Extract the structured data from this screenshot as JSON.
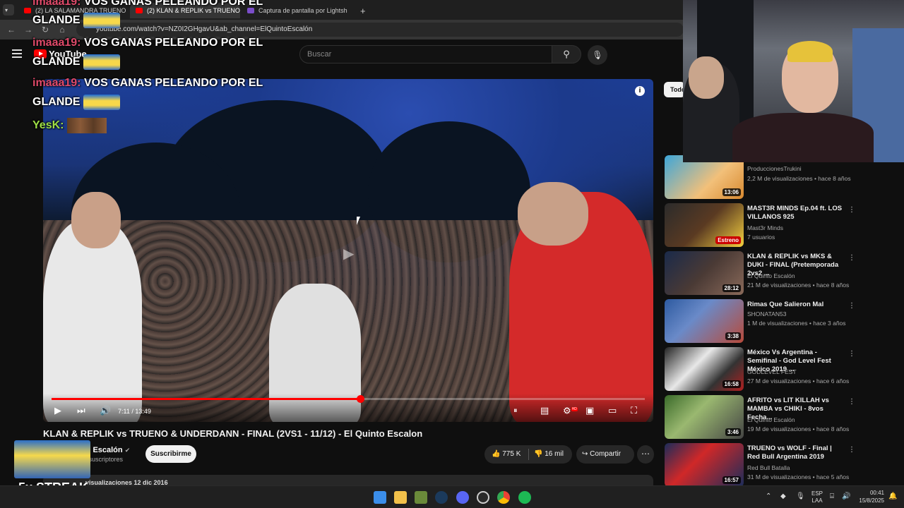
{
  "browser": {
    "tabs": [
      {
        "label": "(2) LA SALAMANDRA TRUENO",
        "close": "×"
      },
      {
        "label": "(2) KLAN & REPLIK vs TRUENO",
        "close": "×"
      },
      {
        "label": "Captura de pantalla por Lightsh",
        "close": "×"
      }
    ],
    "new_tab": "+",
    "url": "youtube.com/watch?v=NZ0I2GHgavU&ab_channel=ElQuintoEscalón"
  },
  "youtube": {
    "logo_text": "YouTube",
    "search_placeholder": "Buscar",
    "player": {
      "time": "7:11 / 13:49",
      "progress_fraction": 0.52,
      "hd_badge": "HD"
    },
    "video_title": "KLAN & REPLIK vs TRUENO & UNDERDANN - FINAL (2VS1 - 11/12) - El Quinto Escalon",
    "channel_name": "to Escalón",
    "subscribers": "e suscriptores",
    "subscribe_label": "Suscribirme",
    "likes": "775 K",
    "dislikes": "16 mil",
    "share_label": "Compartir",
    "description_meta": "visualizaciones  12 dic 2016",
    "chip_label": "Todo",
    "recommendations": [
      {
        "title": "",
        "channel": "ProduccionesTrukini",
        "meta": "2,2 M de visualizaciones • hace 8 años",
        "duration": "13:06",
        "badge": ""
      },
      {
        "title": "MAST3R MINDS Ep.04  ft. LOS VILLANOS 925",
        "channel": "Mast3r Minds",
        "meta": "7 usuarios",
        "duration": "",
        "badge": "Estreno"
      },
      {
        "title": "KLAN & REPLIK vs MKS & DUKI - FINAL (Pretemporada 2vs2 ...",
        "channel": "El Quinto Escalón",
        "meta": "21 M de visualizaciones • hace 8 años",
        "duration": "28:12",
        "badge": ""
      },
      {
        "title": "Rimas Que Salieron Mal",
        "channel": "SHONATAN53",
        "meta": "1 M de visualizaciones • hace 3 años",
        "duration": "3:38",
        "badge": ""
      },
      {
        "title": "México Vs Argentina - Semifinal - God Level Fest México 2019 ...",
        "channel": "GODLEVEL FEST",
        "meta": "27 M de visualizaciones • hace 6 años",
        "duration": "16:58",
        "badge": ""
      },
      {
        "title": "AFRITO vs LIT KILLAH vs MAMBA vs CHIKI - 8vos Fecha...",
        "channel": "El Quinto Escalón",
        "meta": "19 M de visualizaciones • hace 8 años",
        "duration": "3:46",
        "badge": ""
      },
      {
        "title": "TRUENO vs WOLF - Final | Red Bull Argentina 2019",
        "channel": "Red Bull Batalla",
        "meta": "31 M de visualizaciones • hace 5 años",
        "duration": "16:57",
        "badge": ""
      }
    ]
  },
  "overlay": {
    "chat": [
      {
        "user": "imaaa19:",
        "message": "VOS GANAS PELEANDO POR EL",
        "line2": "GLANDE"
      },
      {
        "user": "imaaa19:",
        "message": "VOS GANAS PELEANDO POR EL",
        "line2": "GLANDE"
      },
      {
        "user": "imaaa19:",
        "message": "VOS GANAS PELEANDO POR EL",
        "line2": "GLANDE"
      },
      {
        "user": "YesK:",
        "message": ""
      }
    ],
    "streak_text": "5x STREAK"
  },
  "taskbar": {
    "lang_top": "ESP",
    "lang_bottom": "LAA",
    "time": "00:41",
    "date": "15/8/2025"
  },
  "colors": {
    "accent": "#ff0000",
    "bg": "#0f0f0f"
  }
}
